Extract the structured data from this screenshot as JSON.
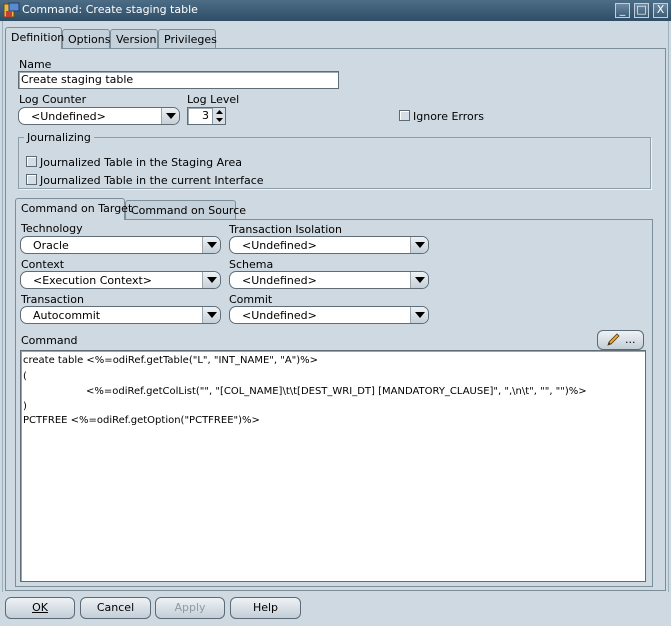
{
  "window": {
    "title": "Command: Create staging table",
    "controls": [
      "_",
      "□",
      "X"
    ]
  },
  "main_tabs": [
    "Definition",
    "Options",
    "Version",
    "Privileges"
  ],
  "definition": {
    "name_label": "Name",
    "name_value": "Create staging table",
    "log_counter_label": "Log Counter",
    "log_counter_value": "<Undefined>",
    "log_level_label": "Log Level",
    "log_level_value": "3",
    "ignore_errors_label": "Ignore Errors",
    "journalizing_title": "Journalizing",
    "journal_opt1": "Journalized Table in the Staging Area",
    "journal_opt2": "Journalized Table in the current Interface"
  },
  "command_tabs": [
    "Command on Target",
    "Command on Source"
  ],
  "target": {
    "technology_label": "Technology",
    "technology_value": "Oracle",
    "isolation_label": "Transaction Isolation",
    "isolation_value": "<Undefined>",
    "context_label": "Context",
    "context_value": "<Execution Context>",
    "schema_label": "Schema",
    "schema_value": "<Undefined>",
    "transaction_label": "Transaction",
    "transaction_value": "Autocommit",
    "commit_label": "Commit",
    "commit_value": "<Undefined>",
    "command_label": "Command",
    "edit_button_label": "..."
  },
  "command_text": [
    "create table <%=odiRef.getTable(\"L\", \"INT_NAME\", \"A\")%>",
    "(",
    "<%=odiRef.getColList(\"\", \"[COL_NAME]\\t\\t[DEST_WRI_DT] [MANDATORY_CLAUSE]\", \",\\n\\t\", \"\", \"\")%>",
    ")",
    "PCTFREE <%=odiRef.getOption(\"PCTFREE\")%>"
  ],
  "buttons": {
    "ok": "OK",
    "cancel": "Cancel",
    "apply": "Apply",
    "help": "Help"
  },
  "colors": {
    "titlebar": "#3d5c75",
    "background": "#cfd9e1"
  }
}
